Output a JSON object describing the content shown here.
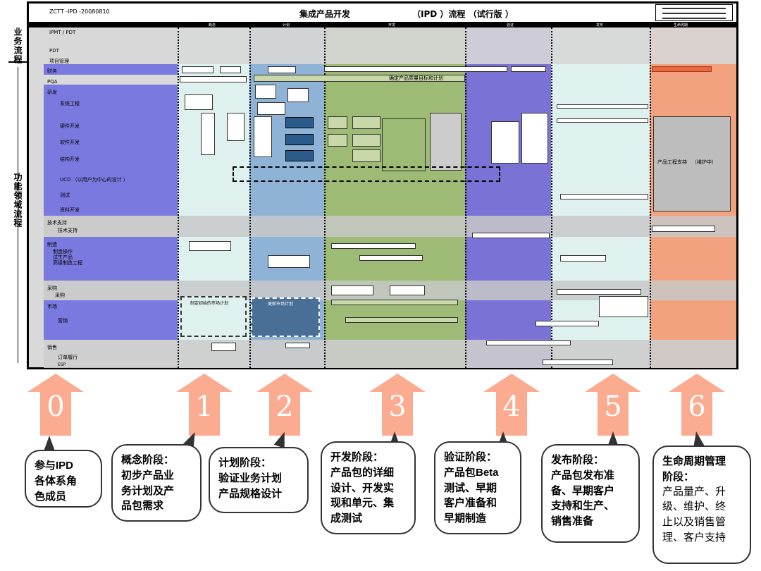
{
  "header": {
    "doc_id": "ZCTT    -IPD   -20080810",
    "title": "集成产品开发",
    "flow": "（IPD    ）流程    （试行版      ）"
  },
  "phases": [
    "概念",
    "计划",
    "开发",
    "验证",
    "发布",
    "生命周期"
  ],
  "left_labels": {
    "business": "业务流程",
    "functional": "功能领域流程"
  },
  "lanes": {
    "ipmt": "IPMT    / PDT",
    "pdt": "PDT",
    "project": "项目管理",
    "finance": "财务",
    "pqa": "PQA",
    "rd": "研发",
    "system_eng": "系统工程",
    "hardware": "硬件开发",
    "software": "软件开发",
    "structure": "结构开发",
    "ucd": "UCD    （以用户为中心的设计         ）",
    "test": "测试",
    "docs": "资料开发",
    "tech_support_group": "技术支持",
    "tech_support": "技术支持",
    "manufacturing_group": "制造",
    "manufacturing": "制造操作",
    "trial": "试生产品",
    "mfg_eng": "高级制造工程",
    "purchase_group": "采购",
    "purchase": "采购",
    "market_group": "市场",
    "marketing": "营销",
    "sales_group": "销售",
    "order": "订单履行",
    "esp": "ESP"
  },
  "inner_labels": {
    "dev_plan": "确定产品质量目标和计划",
    "pe_support": "产品工程支持",
    "maintain": "（维护中）",
    "market_plan": "制定初始的市场计划",
    "market_plan2": "更新市场计划"
  },
  "arrows": [
    "0",
    "1",
    "2",
    "3",
    "4",
    "5",
    "6"
  ],
  "bubbles": [
    {
      "title": "参与IPD",
      "lines": [
        "各体系角",
        "色成员"
      ]
    },
    {
      "title": "概念阶段：",
      "lines": [
        "初步产品业",
        "务计划及产",
        "品包需求"
      ]
    },
    {
      "title": "计划阶段：",
      "lines": [
        "验证业务计划",
        "产品规格设计"
      ]
    },
    {
      "title": "开发阶段：",
      "lines": [
        "产品包的详细",
        "设计、开发实",
        "现和单元、集",
        "成测试"
      ]
    },
    {
      "title": "验证阶段：",
      "lines": [
        "产品包Beta",
        "测试、早期",
        "客户准备和",
        "早期制造"
      ]
    },
    {
      "title": "发布阶段：",
      "lines": [
        "产品包发布准",
        "备、早期客户",
        "支持和生产、",
        "销售准备"
      ]
    },
    {
      "title": "生命周期管理",
      "lines": [
        "阶段：",
        "产品量产、升",
        "级、维护、终",
        "止以及销售管",
        "理、客户支持"
      ]
    }
  ],
  "colors": {
    "arrow": "#fbab8f",
    "concept": "#dff1ee",
    "plan": "#8fb3d6",
    "develop": "#9dbb74",
    "verify": "#7b72d6",
    "release": "#dff1ee",
    "lifecycle": "#f2a27e",
    "functional_blue": "#7a79e0"
  }
}
